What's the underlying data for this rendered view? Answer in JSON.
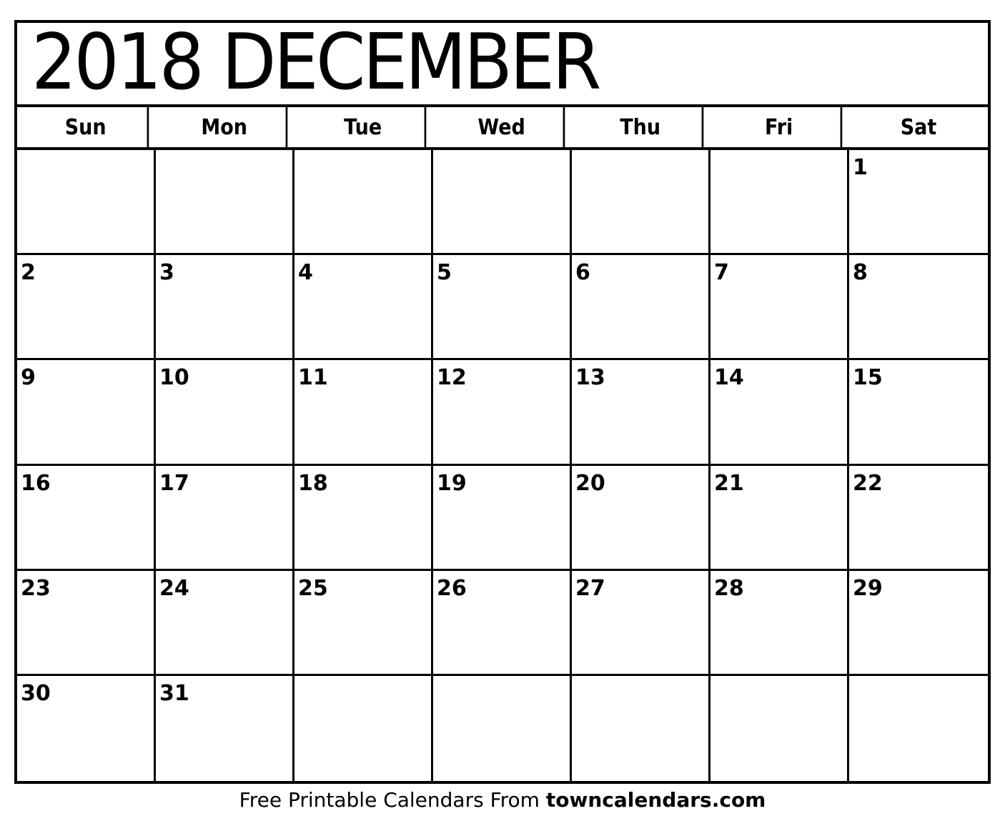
{
  "title": "2018 DECEMBER",
  "weekdays": [
    "Sun",
    "Mon",
    "Tue",
    "Wed",
    "Thu",
    "Fri",
    "Sat"
  ],
  "weeks": [
    [
      "",
      "",
      "",
      "",
      "",
      "",
      "1"
    ],
    [
      "2",
      "3",
      "4",
      "5",
      "6",
      "7",
      "8"
    ],
    [
      "9",
      "10",
      "11",
      "12",
      "13",
      "14",
      "15"
    ],
    [
      "16",
      "17",
      "18",
      "19",
      "20",
      "21",
      "22"
    ],
    [
      "23",
      "24",
      "25",
      "26",
      "27",
      "28",
      "29"
    ],
    [
      "30",
      "31",
      "",
      "",
      "",
      "",
      ""
    ]
  ],
  "footer": {
    "text": "Free Printable Calendars From ",
    "site": "towncalendars.com"
  }
}
